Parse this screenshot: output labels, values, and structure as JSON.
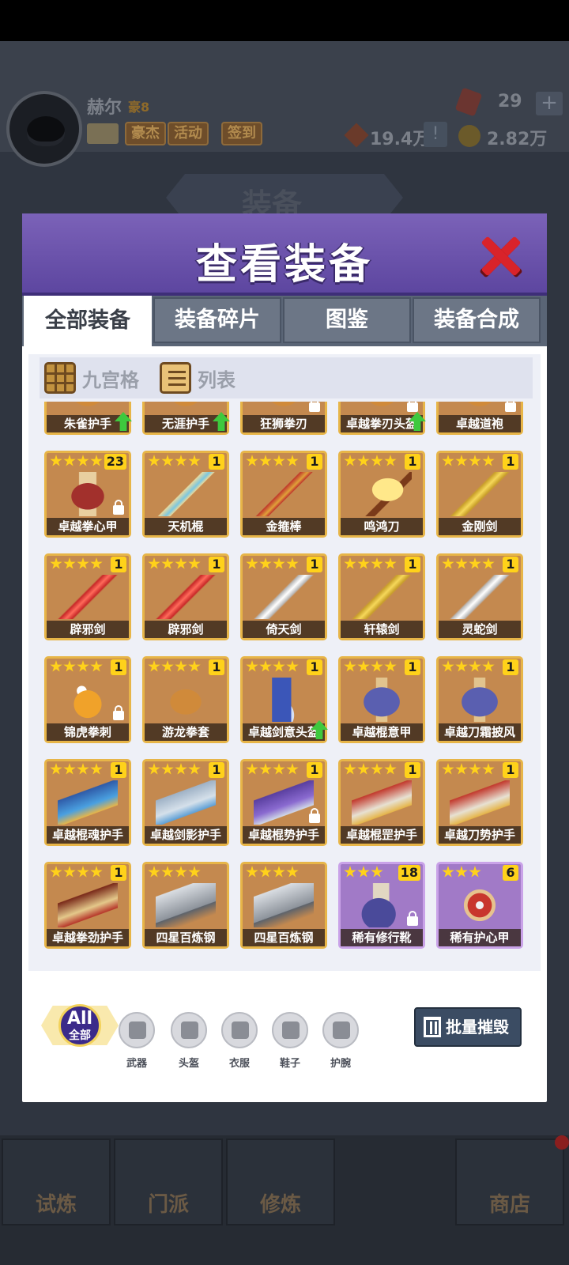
{
  "header": {
    "player_name": "赫尔",
    "vip_label": "豪8",
    "tags": [
      "豪杰",
      "活动",
      "签到"
    ],
    "gems": "29",
    "power": "19.4万",
    "gold": "2.82万",
    "screen_title": "装备"
  },
  "modal": {
    "title": "查看装备",
    "tabs": [
      "全部装备",
      "装备碎片",
      "图鉴",
      "装备合成"
    ],
    "active_tab": "全部装备",
    "view_options": [
      "九宫格",
      "列表"
    ]
  },
  "items": [
    {
      "name": "朱雀护手",
      "stars": 4,
      "count": "",
      "locked": false,
      "upgrade": true,
      "rarity": "gold",
      "icon": "gauntlet-icon"
    },
    {
      "name": "无涯护手",
      "stars": 4,
      "count": "",
      "locked": false,
      "upgrade": true,
      "rarity": "gold",
      "icon": "gauntlet-icon"
    },
    {
      "name": "狂狮拳刃",
      "stars": 4,
      "count": "",
      "locked": true,
      "upgrade": false,
      "rarity": "gold",
      "icon": "claw-icon"
    },
    {
      "name": "卓越拳刃头盔",
      "stars": 4,
      "count": "",
      "locked": true,
      "upgrade": true,
      "rarity": "gold",
      "icon": "helmet-icon"
    },
    {
      "name": "卓越道袍",
      "stars": 4,
      "count": "",
      "locked": true,
      "upgrade": false,
      "rarity": "gold",
      "icon": "robe-icon"
    },
    {
      "name": "卓越拳心甲",
      "stars": 4,
      "count": "23",
      "locked": true,
      "upgrade": false,
      "rarity": "gold",
      "icon": "armor-icon",
      "art": "a-armor"
    },
    {
      "name": "天机棍",
      "stars": 4,
      "count": "1",
      "locked": false,
      "upgrade": false,
      "rarity": "gold",
      "icon": "staff-icon",
      "art": "a-staff"
    },
    {
      "name": "金箍棒",
      "stars": 4,
      "count": "1",
      "locked": false,
      "upgrade": false,
      "rarity": "gold",
      "icon": "rod-icon",
      "art": "a-rod"
    },
    {
      "name": "鸣鸿刀",
      "stars": 4,
      "count": "1",
      "locked": false,
      "upgrade": false,
      "rarity": "gold",
      "icon": "blade-icon",
      "art": "a-blade"
    },
    {
      "name": "金刚剑",
      "stars": 4,
      "count": "1",
      "locked": false,
      "upgrade": false,
      "rarity": "gold",
      "icon": "sword-icon",
      "art": "a-sword-gold"
    },
    {
      "name": "辟邪剑",
      "stars": 4,
      "count": "1",
      "locked": false,
      "upgrade": false,
      "rarity": "gold",
      "icon": "sword-icon",
      "art": "a-sword-red"
    },
    {
      "name": "辟邪剑",
      "stars": 4,
      "count": "1",
      "locked": false,
      "upgrade": false,
      "rarity": "gold",
      "icon": "sword-icon",
      "art": "a-sword-red"
    },
    {
      "name": "倚天剑",
      "stars": 4,
      "count": "1",
      "locked": false,
      "upgrade": false,
      "rarity": "gold",
      "icon": "sword-icon",
      "art": "a-sword-silver"
    },
    {
      "name": "轩辕剑",
      "stars": 4,
      "count": "1",
      "locked": false,
      "upgrade": false,
      "rarity": "gold",
      "icon": "sword-icon",
      "art": "a-sword-gold"
    },
    {
      "name": "灵蛇剑",
      "stars": 4,
      "count": "1",
      "locked": false,
      "upgrade": false,
      "rarity": "gold",
      "icon": "sword-icon",
      "art": "a-sword-silver"
    },
    {
      "name": "锦虎拳刺",
      "stars": 4,
      "count": "1",
      "locked": true,
      "upgrade": false,
      "rarity": "gold",
      "icon": "claw-icon",
      "art": "a-claw"
    },
    {
      "name": "游龙拳套",
      "stars": 4,
      "count": "1",
      "locked": false,
      "upgrade": false,
      "rarity": "gold",
      "icon": "glove-icon",
      "art": "a-glove"
    },
    {
      "name": "卓越剑意头盔",
      "stars": 4,
      "count": "1",
      "locked": false,
      "upgrade": true,
      "rarity": "gold",
      "icon": "helmet-icon",
      "art": "a-helm"
    },
    {
      "name": "卓越棍意甲",
      "stars": 4,
      "count": "1",
      "locked": false,
      "upgrade": false,
      "rarity": "gold",
      "icon": "armor-icon",
      "art": "a-robe"
    },
    {
      "name": "卓越刀霜披风",
      "stars": 4,
      "count": "1",
      "locked": false,
      "upgrade": false,
      "rarity": "gold",
      "icon": "cloak-icon",
      "art": "a-robe"
    },
    {
      "name": "卓越棍魂护手",
      "stars": 4,
      "count": "1",
      "locked": false,
      "upgrade": false,
      "rarity": "gold",
      "icon": "gauntlet-icon",
      "art": "a-guard-blue"
    },
    {
      "name": "卓越剑影护手",
      "stars": 4,
      "count": "1",
      "locked": false,
      "upgrade": false,
      "rarity": "gold",
      "icon": "gauntlet-icon",
      "art": "a-guard-silver"
    },
    {
      "name": "卓越棍势护手",
      "stars": 4,
      "count": "1",
      "locked": true,
      "upgrade": false,
      "rarity": "gold",
      "icon": "gauntlet-icon",
      "art": "a-guard-purple"
    },
    {
      "name": "卓越棍罡护手",
      "stars": 4,
      "count": "1",
      "locked": false,
      "upgrade": false,
      "rarity": "gold",
      "icon": "gauntlet-icon",
      "art": "a-guard-red"
    },
    {
      "name": "卓越刀势护手",
      "stars": 4,
      "count": "1",
      "locked": false,
      "upgrade": false,
      "rarity": "gold",
      "icon": "gauntlet-icon",
      "art": "a-guard-red"
    },
    {
      "name": "卓越拳劲护手",
      "stars": 4,
      "count": "1",
      "locked": false,
      "upgrade": false,
      "rarity": "gold",
      "icon": "gauntlet-icon",
      "art": "a-guard-brown"
    },
    {
      "name": "四星百炼钢",
      "stars": 4,
      "count": "",
      "locked": false,
      "upgrade": false,
      "rarity": "gold",
      "icon": "ingot-icon",
      "art": "a-ingot"
    },
    {
      "name": "四星百炼钢",
      "stars": 4,
      "count": "",
      "locked": false,
      "upgrade": false,
      "rarity": "gold",
      "icon": "ingot-icon",
      "art": "a-ingot"
    },
    {
      "name": "稀有修行靴",
      "stars": 3,
      "count": "18",
      "locked": true,
      "upgrade": false,
      "rarity": "purple",
      "icon": "boot-icon",
      "art": "a-boot"
    },
    {
      "name": "稀有护心甲",
      "stars": 3,
      "count": "6",
      "locked": false,
      "upgrade": false,
      "rarity": "purple",
      "icon": "chest-armor-icon",
      "art": "a-chest"
    }
  ],
  "filters": {
    "all_big": "All",
    "all_small": "全部",
    "categories": [
      {
        "label": "武器",
        "icon": "weapon-icon"
      },
      {
        "label": "头盔",
        "icon": "helmet-icon"
      },
      {
        "label": "衣服",
        "icon": "clothes-icon"
      },
      {
        "label": "鞋子",
        "icon": "boot-icon"
      },
      {
        "label": "护腕",
        "icon": "bracer-icon"
      }
    ],
    "batch_destroy": "批量摧毁"
  },
  "bottom_nav": [
    "试炼",
    "门派",
    "修炼",
    "商店"
  ],
  "colors": {
    "modal_header": "#6a52ab",
    "item_gold_border": "#e7b548",
    "item_purple": "#a17ac7",
    "star": "#ffd21a"
  }
}
